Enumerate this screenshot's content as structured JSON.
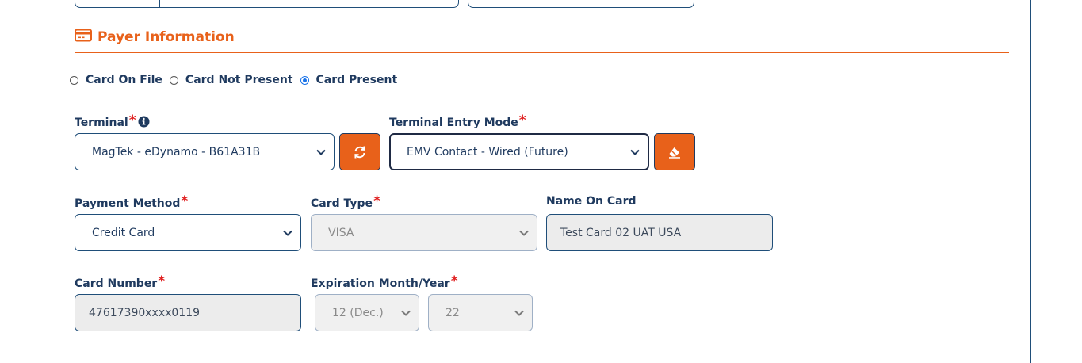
{
  "section": {
    "title": "Payer Information",
    "icon": "credit-card-icon"
  },
  "radios": [
    {
      "label": "Card On File",
      "checked": false
    },
    {
      "label": "Card Not Present",
      "checked": false
    },
    {
      "label": "Card Present",
      "checked": true
    }
  ],
  "terminal": {
    "label": "Terminal",
    "value": "MagTek - eDynamo - B61A31B",
    "info_icon": "info-icon"
  },
  "refresh_button": {
    "icon": "refresh-icon"
  },
  "entry_mode": {
    "label": "Terminal Entry Mode",
    "value": "EMV Contact - Wired (Future)"
  },
  "eraser_button": {
    "icon": "eraser-icon"
  },
  "payment_method": {
    "label": "Payment Method",
    "value": "Credit Card"
  },
  "card_type": {
    "label": "Card Type",
    "value": "VISA"
  },
  "name_on_card": {
    "label": "Name On Card",
    "value": "Test Card 02 UAT USA"
  },
  "card_number": {
    "label": "Card Number",
    "value": "47617390xxxx0119"
  },
  "expiration": {
    "label": "Expiration Month/Year",
    "month": "12 (Dec.)",
    "year": "22"
  },
  "required_mark": "*",
  "colors": {
    "accent": "#e8611a",
    "primary": "#1f3a5f",
    "required": "#e02020",
    "radio_selected": "#1a73e8"
  }
}
